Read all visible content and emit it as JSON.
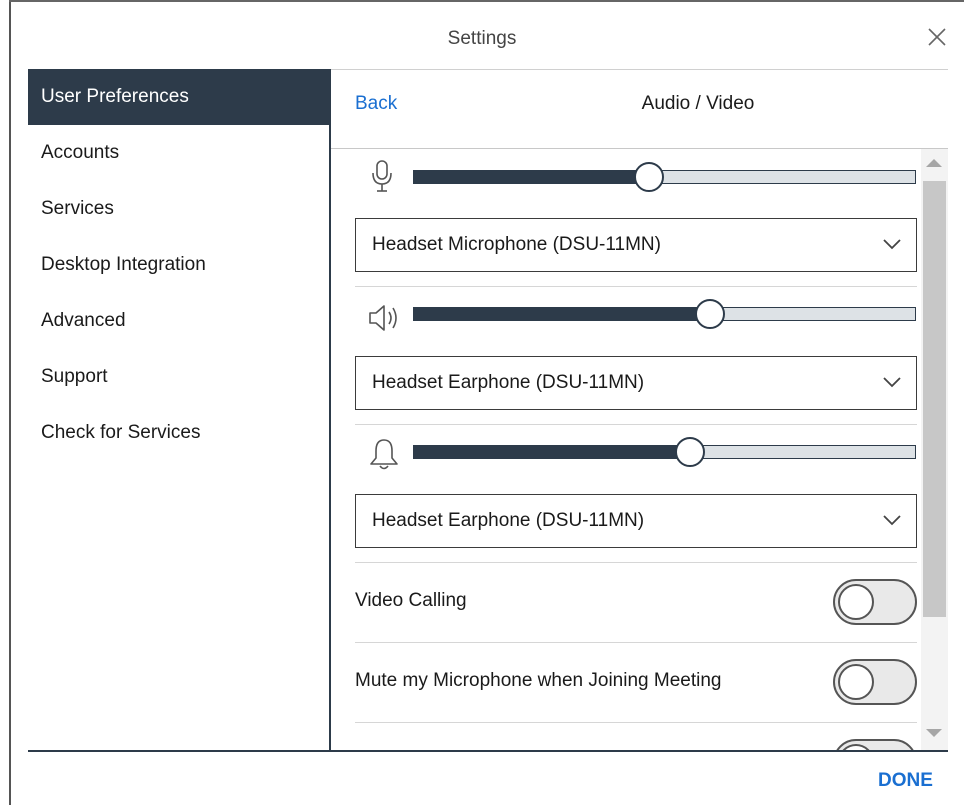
{
  "window": {
    "title": "Settings",
    "close_icon": "close-icon"
  },
  "sidebar": {
    "items": [
      {
        "label": "User Preferences",
        "active": true
      },
      {
        "label": "Accounts",
        "active": false
      },
      {
        "label": "Services",
        "active": false
      },
      {
        "label": "Desktop Integration",
        "active": false
      },
      {
        "label": "Advanced",
        "active": false
      },
      {
        "label": "Support",
        "active": false
      },
      {
        "label": "Check for Services",
        "active": false
      }
    ]
  },
  "panel": {
    "back_label": "Back",
    "title": "Audio / Video",
    "microphone": {
      "icon": "microphone-icon",
      "level_percent": 47,
      "device": "Headset Microphone (DSU-11MN)"
    },
    "speaker": {
      "icon": "speaker-icon",
      "level_percent": 59,
      "device": "Headset Earphone (DSU-11MN)"
    },
    "ringer": {
      "icon": "bell-icon",
      "level_percent": 55,
      "device": "Headset Earphone (DSU-11MN)"
    },
    "toggles": [
      {
        "label": "Video Calling",
        "on": false
      },
      {
        "label": "Mute my Microphone when Joining Meeting",
        "on": false
      }
    ]
  },
  "footer": {
    "done_label": "DONE"
  },
  "colors": {
    "accent": "#1a6fd1",
    "sidebar_active_bg": "#2d3b4a",
    "slider_fill": "#2d3b4a"
  }
}
